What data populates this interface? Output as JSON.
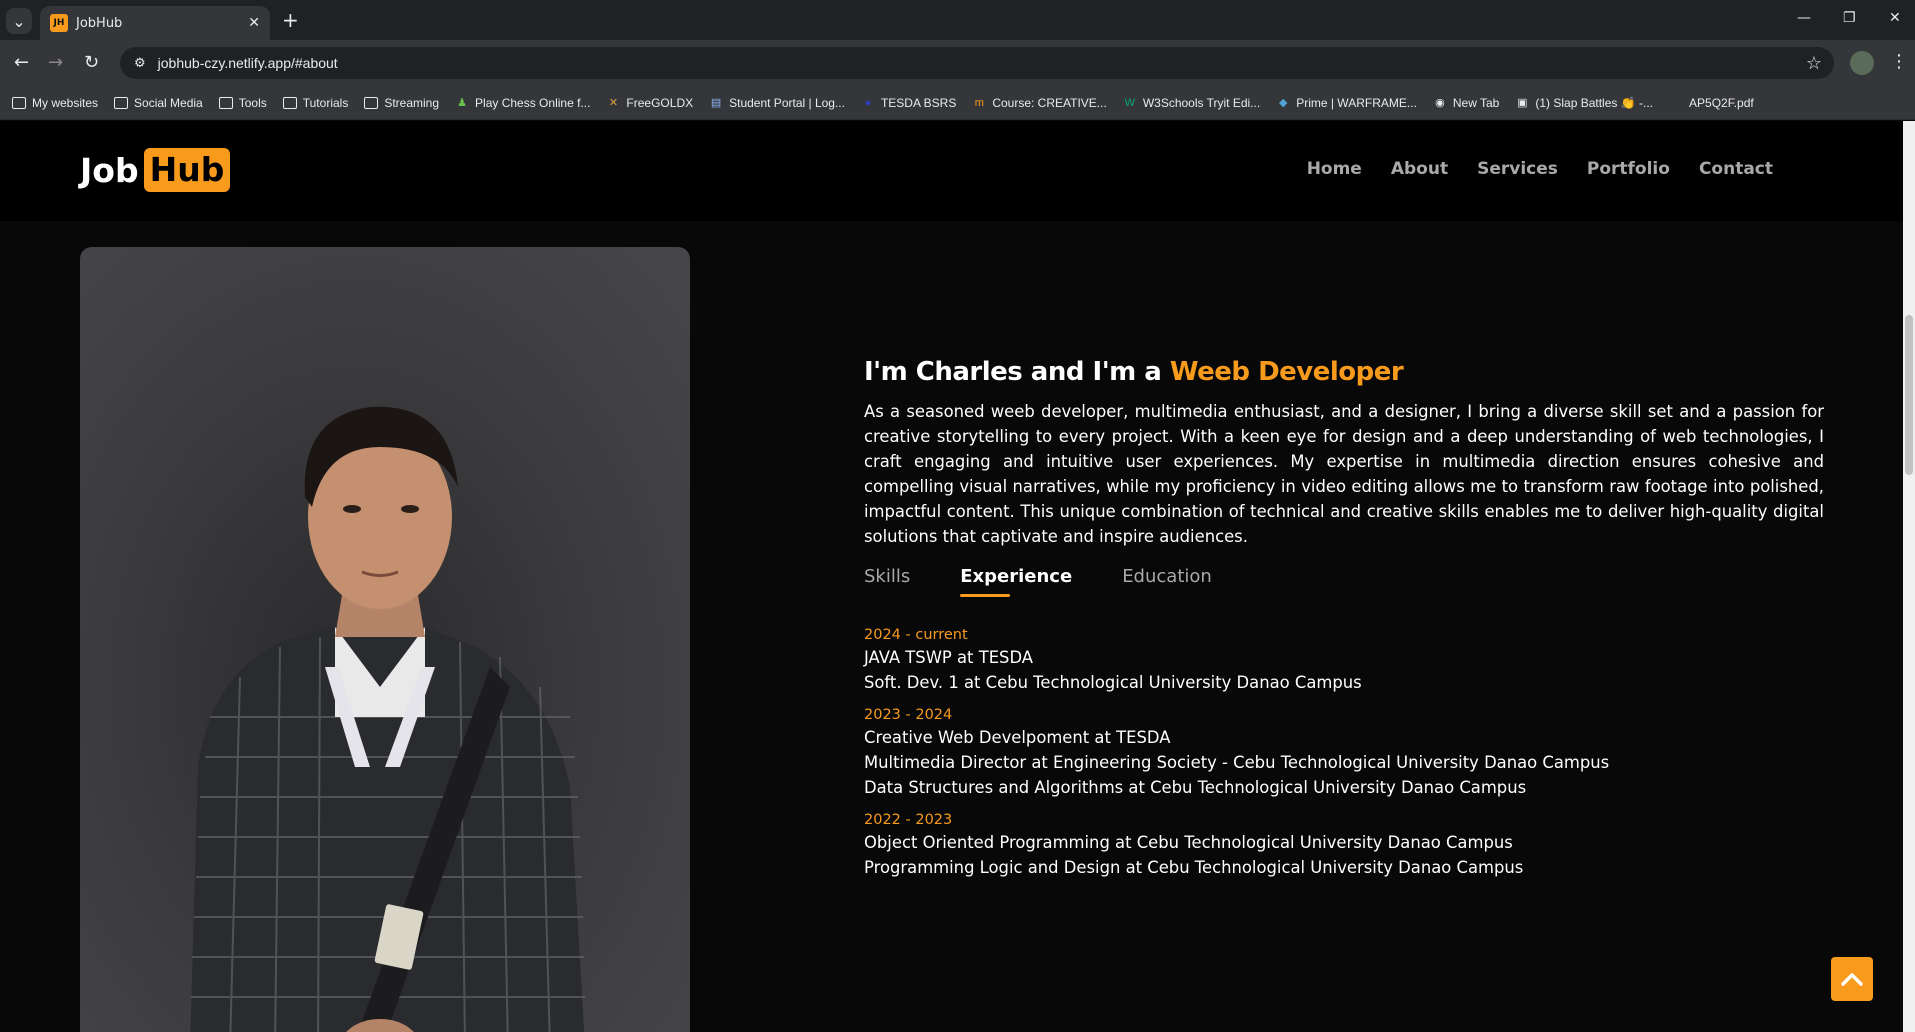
{
  "browser": {
    "tab_title": "JobHub",
    "favicon_text": "JH",
    "url": "jobhub-czy.netlify.app/#about",
    "bookmarks": [
      {
        "label": "My websites",
        "icon": "folder-icon"
      },
      {
        "label": "Social Media",
        "icon": "folder-icon"
      },
      {
        "label": "Tools",
        "icon": "folder-icon"
      },
      {
        "label": "Tutorials",
        "icon": "folder-icon"
      },
      {
        "label": "Streaming",
        "icon": "folder-icon"
      },
      {
        "label": "Play Chess Online f...",
        "icon": "chess-icon"
      },
      {
        "label": "FreeGOLDX",
        "icon": "x-icon"
      },
      {
        "label": "Student Portal | Log...",
        "icon": "doc-icon"
      },
      {
        "label": "TESDA BSRS",
        "icon": "globe-icon"
      },
      {
        "label": "Course: CREATIVE...",
        "icon": "course-icon"
      },
      {
        "label": "W3Schools Tryit Edi...",
        "icon": "w3-icon"
      },
      {
        "label": "Prime | WARFRAME...",
        "icon": "prime-icon"
      },
      {
        "label": "New Tab",
        "icon": "chrome-icon"
      },
      {
        "label": "(1) Slap Battles 👏 -...",
        "icon": "roblox-icon"
      },
      {
        "label": "AP5Q2F.pdf",
        "icon": "pdf-icon"
      }
    ]
  },
  "header": {
    "logo_left": "Job",
    "logo_right": "Hub",
    "nav": [
      "Home",
      "About",
      "Services",
      "Portfolio",
      "Contact"
    ]
  },
  "about": {
    "title_prefix": "I'm Charles and I'm a ",
    "title_accent": "Weeb Developer",
    "description": "As a seasoned weeb developer, multimedia enthusiast, and a designer, I bring a diverse skill set and a passion for creative storytelling to every project. With a keen eye for design and a deep understanding of web technologies, I craft engaging and intuitive user experiences. My expertise in multimedia direction ensures cohesive and compelling visual narratives, while my proficiency in video editing allows me to transform raw footage into polished, impactful content. This unique combination of technical and creative skills enables me to deliver high-quality digital solutions that captivate and inspire audiences.",
    "tabs": [
      "Skills",
      "Experience",
      "Education"
    ],
    "active_tab": "Experience",
    "experience": [
      {
        "year": "2024 - current",
        "items": [
          "JAVA TSWP at TESDA",
          "Soft. Dev. 1 at Cebu Technological University Danao Campus"
        ]
      },
      {
        "year": "2023 - 2024",
        "items": [
          "Creative Web Develpoment at TESDA",
          "Multimedia Director at Engineering Society - Cebu Technological University Danao Campus",
          "Data Structures and Algorithms at Cebu Technological University Danao Campus"
        ]
      },
      {
        "year": "2022 - 2023",
        "items": [
          "Object Oriented Programming at Cebu Technological University Danao Campus",
          "Programming Logic and Design at Cebu Technological University Danao Campus"
        ]
      }
    ]
  },
  "colors": {
    "accent": "#f89b1c",
    "background": "#080808",
    "card": "#3c3c3f"
  }
}
